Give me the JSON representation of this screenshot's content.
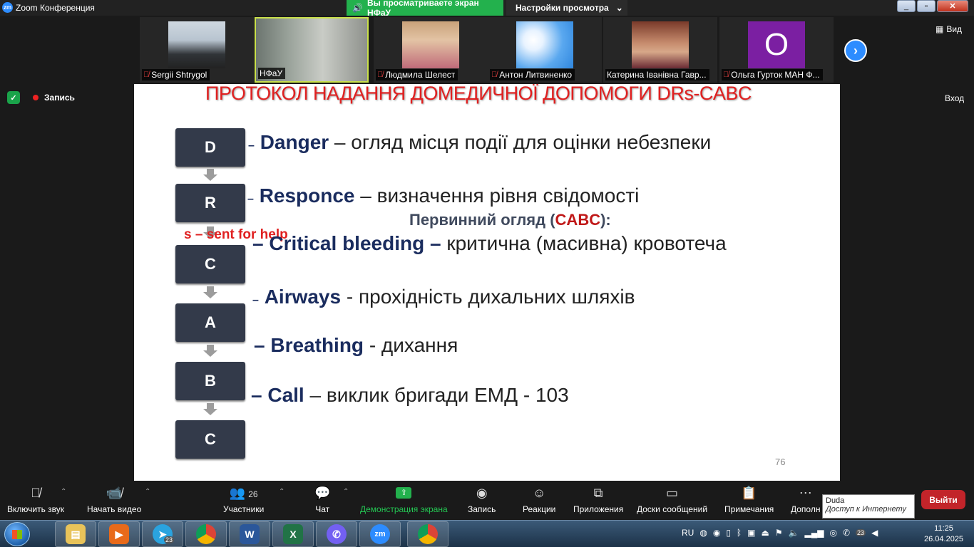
{
  "window": {
    "logo": "zm",
    "title": "Zoom Конференция",
    "min": "_",
    "max": "▫",
    "close": "✕"
  },
  "share_banner": {
    "text": "Вы просматриваете экран НФаУ",
    "icon": "speaker-icon"
  },
  "view_options": {
    "label": "Настройки просмотра",
    "icon": "chevron-down-icon"
  },
  "participants": [
    {
      "name": "Sergii Shtrygol",
      "muted": true
    },
    {
      "name": "НФаУ",
      "muted": false,
      "active": true
    },
    {
      "name": "Людмила Шелест",
      "muted": true
    },
    {
      "name": "Антон Литвиненко",
      "muted": true
    },
    {
      "name": "Катерина Іванівна Гавр...",
      "muted": false
    },
    {
      "name": "Ольга Гурток МАН Ф...",
      "muted": true,
      "avatar_letter": "О"
    }
  ],
  "next_arrow": "›",
  "view_button": {
    "label": "Вид",
    "icon": "grid-icon"
  },
  "recording": {
    "label": "Запись"
  },
  "login": {
    "label": "Вход"
  },
  "slide": {
    "title": "ПРОТОКОЛ НАДАННЯ ДОМЕДИЧНОЇ ДОПОМОГИ DRs-CABC",
    "boxes": [
      "D",
      "R",
      "C",
      "A",
      "B",
      "C"
    ],
    "lines": [
      {
        "dash": "–",
        "key": "Danger",
        "text": " – огляд місця події для оцінки небезпеки"
      },
      {
        "dash": "–",
        "key": "Responce",
        "text": " – визначення рівня свідомості"
      },
      {
        "dash": "– ",
        "key": "Critical bleeding",
        "sep": " –",
        "text": " критична (масивна) кровотеча"
      },
      {
        "dash": "–",
        "key": "Airways",
        "text": " - прохідність дихальних шляхів"
      },
      {
        "dash": "– ",
        "key": "Breathing",
        "text": " - дихання"
      },
      {
        "dash": "– ",
        "key": "Call",
        "text": " – виклик бригади ЕМД - 103"
      }
    ],
    "primary_prefix": "Первинний огляд (",
    "primary_cabc": "CABC",
    "primary_suffix": "):",
    "sent_help": "s – sent for help",
    "page_number": "76"
  },
  "toolbar": {
    "mute": "Включить звук",
    "video": "Начать видео",
    "participants": "Участники",
    "participants_count": "26",
    "chat": "Чат",
    "share": "Демонстрация экрана",
    "record": "Запись",
    "reactions": "Реакции",
    "apps": "Приложения",
    "whiteboards": "Доски сообщений",
    "notes": "Примечания",
    "more": "Дополн",
    "exit": "Выйти"
  },
  "tooltip": {
    "title": "Duda",
    "subtitle": "Доступ к Интернету"
  },
  "taskbar": {
    "language": "RU",
    "time": "11:25",
    "date": "26.04.2025",
    "badges": {
      "telegram": "23",
      "tray": "23"
    },
    "apps": [
      "explorer",
      "media-player",
      "telegram",
      "chrome",
      "word",
      "excel",
      "viber",
      "zoom",
      "chrome-profile"
    ]
  },
  "colors": {
    "share_green": "#23b14d",
    "zoom_blue": "#2d8cff",
    "exit_red": "#c2242a",
    "title_red": "#e02020",
    "key_navy": "#1a2c5e"
  }
}
